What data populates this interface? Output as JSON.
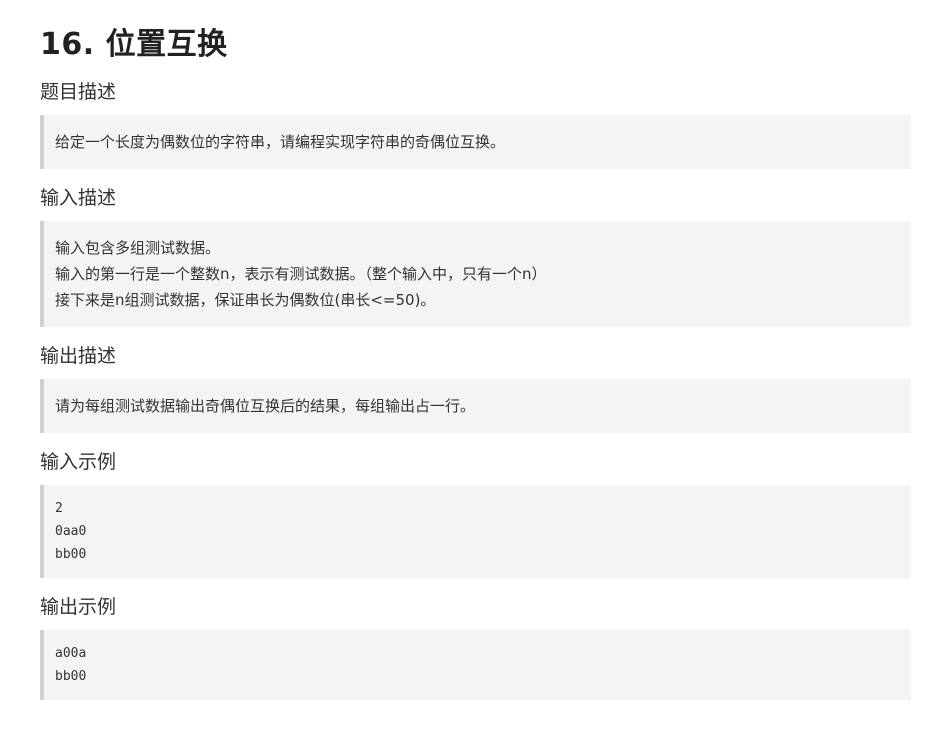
{
  "page_title": "16. 位置互换",
  "sections": [
    {
      "heading": "题目描述",
      "lines": [
        "给定一个长度为偶数位的字符串，请编程实现字符串的奇偶位互换。"
      ]
    },
    {
      "heading": "输入描述",
      "lines": [
        "输入包含多组测试数据。",
        "输入的第一行是一个整数n，表示有测试数据。（整个输入中，只有一个n）",
        "接下来是n组测试数据，保证串长为偶数位(串长<=50)。"
      ]
    },
    {
      "heading": "输出描述",
      "lines": [
        "请为每组测试数据输出奇偶位互换后的结果，每组输出占一行。"
      ]
    },
    {
      "heading": "输入示例",
      "lines": [
        "2",
        "0aa0",
        "bb00"
      ]
    },
    {
      "heading": "输出示例",
      "lines": [
        "a00a",
        "bb00"
      ]
    }
  ]
}
